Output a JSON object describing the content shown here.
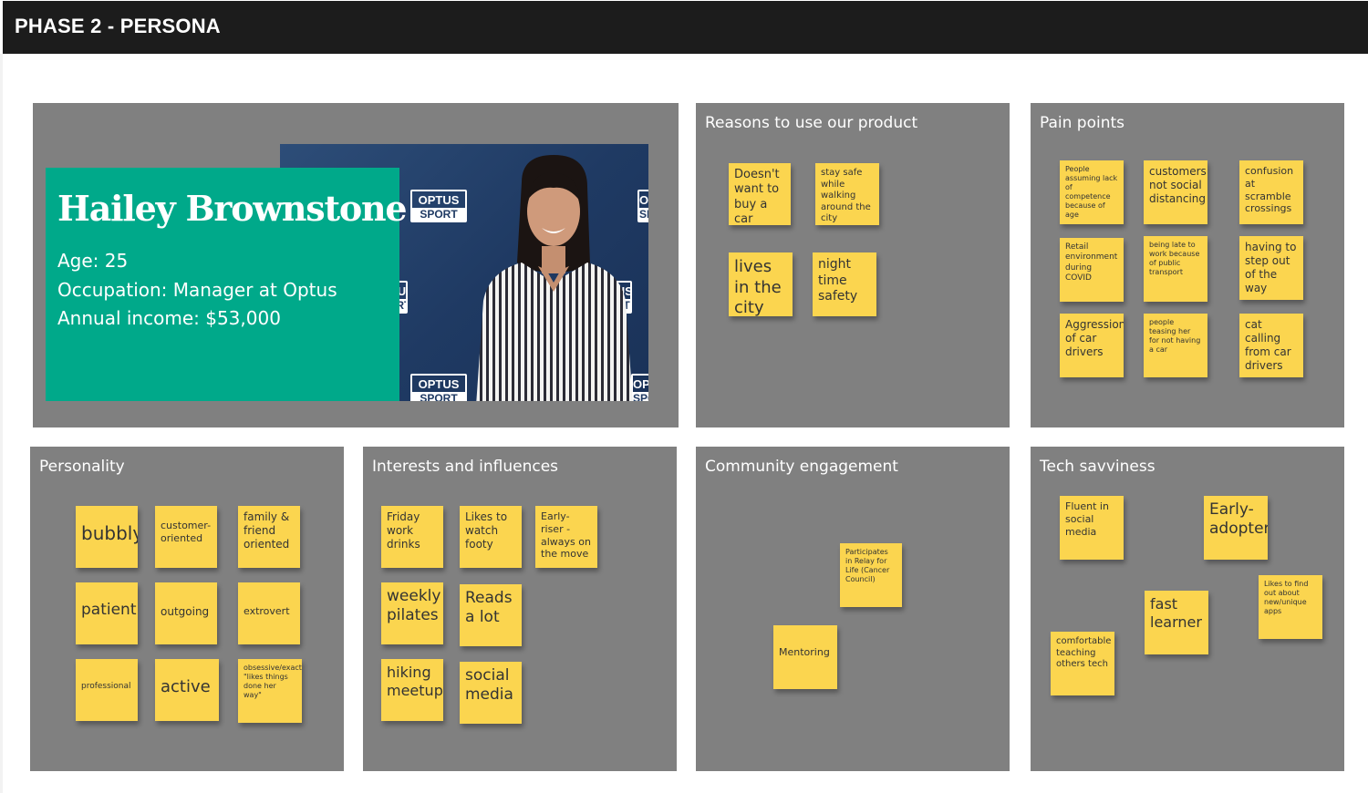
{
  "header": {
    "title": "PHASE 2 - PERSONA"
  },
  "persona": {
    "name": "Hailey Brownstone",
    "age": "Age: 25",
    "occupation": "Occupation: Manager at Optus",
    "income": "Annual income: $53,000",
    "photo_logo_top": "OPTUS",
    "photo_logo_bottom": "SPORT"
  },
  "reasons": {
    "title": "Reasons to use our product",
    "notes": [
      "Doesn't want to buy a car",
      "stay safe while walking around the city",
      "lives in the city",
      "night time safety"
    ]
  },
  "pain_points": {
    "title": "Pain points",
    "notes": [
      "People assuming lack of competence because of age",
      "customers not social distancing",
      "confusion at scramble crossings",
      "Retail environment during COVID",
      "being late to work because of public transport",
      "having to step out of the way",
      "Aggression of car drivers",
      "people teasing her for not having a car",
      "cat calling from car drivers"
    ]
  },
  "personality": {
    "title": "Personality",
    "notes": [
      "bubbly",
      "customer-oriented",
      "family & friend oriented",
      "patient",
      "outgoing",
      "extrovert",
      "professional",
      "active",
      "obsessive/exacting/controlling \"likes things done her way\""
    ]
  },
  "interests": {
    "title": "Interests and influences",
    "notes": [
      "Friday work drinks",
      "Likes to watch footy",
      "Early-riser - always on the move",
      "weekly pilates",
      "Reads a lot",
      "hiking meetup",
      "social media"
    ]
  },
  "community": {
    "title": "Community engagement",
    "notes": [
      "Participates in Relay for Life (Cancer Council)",
      "Mentoring"
    ]
  },
  "tech": {
    "title": "Tech savviness",
    "notes": [
      "Fluent in social media",
      "Early-adopter",
      "Likes to find out about new/unique apps",
      "fast learner",
      "comfortable teaching others tech"
    ]
  },
  "colors": {
    "topbar": "#1c1c1c",
    "panel": "#808080",
    "sticky": "#fbd54f",
    "persona_card": "#00a98a",
    "photo_background": "#1f3a63"
  },
  "icons": {
    "photo": "portrait-photo"
  }
}
